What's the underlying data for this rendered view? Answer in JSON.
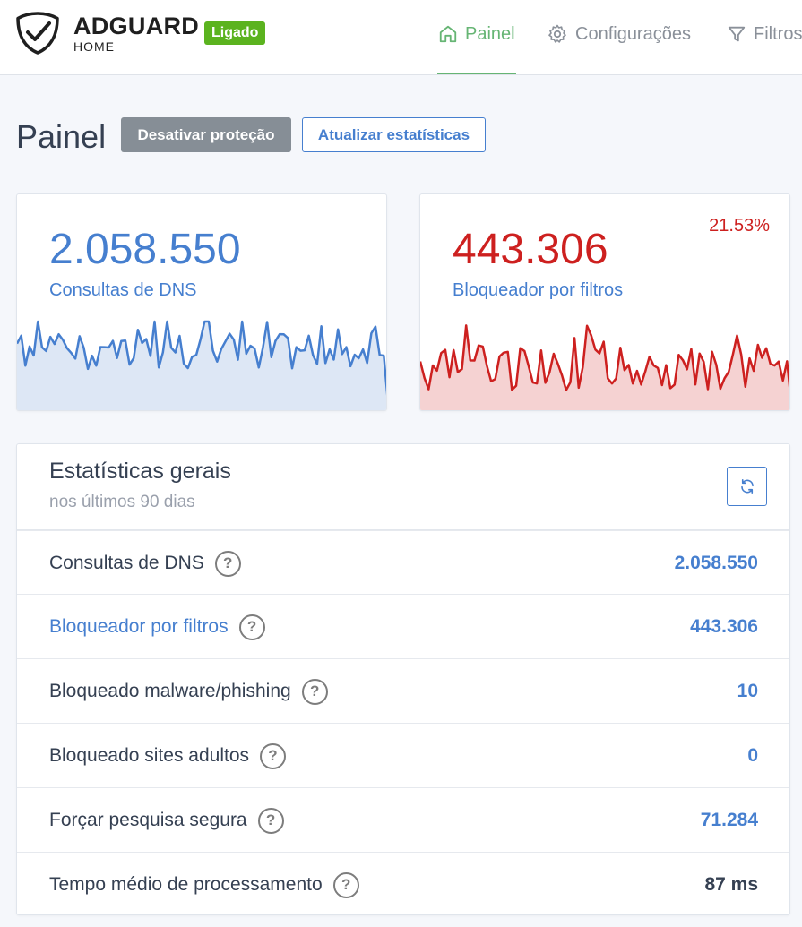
{
  "header": {
    "brand": "ADGUARD",
    "brand_sub": "HOME",
    "status_badge": "Ligado",
    "nav": [
      {
        "label": "Painel",
        "icon": "home-icon",
        "active": true
      },
      {
        "label": "Configurações",
        "icon": "gear-icon",
        "active": false
      },
      {
        "label": "Filtros",
        "icon": "filter-icon",
        "active": false
      }
    ]
  },
  "page": {
    "title": "Painel",
    "disable_button": "Desativar proteção",
    "refresh_stats_button": "Atualizar estatísticas"
  },
  "cards": {
    "dns": {
      "value": "2.058.550",
      "label": "Consultas de DNS",
      "color": "#467fcf"
    },
    "blocked": {
      "value": "443.306",
      "label": "Bloqueador por filtros",
      "percent": "21.53%",
      "color": "#cd201f"
    }
  },
  "general": {
    "title": "Estatísticas gerais",
    "subtitle": "nos últimos 90 dias",
    "rows": [
      {
        "label": "Consultas de DNS",
        "value": "2.058.550"
      },
      {
        "label": "Bloqueador por filtros",
        "value": "443.306"
      },
      {
        "label": "Bloqueado malware/phishing",
        "value": "10"
      },
      {
        "label": "Bloqueado sites adultos",
        "value": "0"
      },
      {
        "label": "Forçar pesquisa segura",
        "value": "71.284"
      },
      {
        "label": "Tempo médio de processamento",
        "value": "87 ms"
      }
    ]
  },
  "colors": {
    "accent": "#467fcf",
    "danger": "#cd201f",
    "success": "#5bb31f",
    "nav_active": "#66b574"
  }
}
